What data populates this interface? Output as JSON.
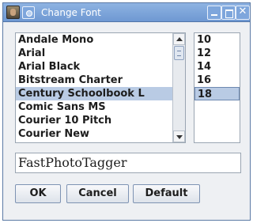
{
  "window": {
    "title": "Change Font"
  },
  "font_list": {
    "items": [
      {
        "label": "Andale Mono"
      },
      {
        "label": "Arial"
      },
      {
        "label": "Arial Black"
      },
      {
        "label": "Bitstream Charter"
      },
      {
        "label": "Century Schoolbook L",
        "selected": true
      },
      {
        "label": "Comic Sans MS"
      },
      {
        "label": "Courier 10 Pitch"
      },
      {
        "label": "Courier New"
      }
    ]
  },
  "size_list": {
    "items": [
      {
        "label": "10"
      },
      {
        "label": "12"
      },
      {
        "label": "14"
      },
      {
        "label": "16"
      },
      {
        "label": "18",
        "selected": true
      }
    ]
  },
  "preview": {
    "text": "FastPhotoTagger"
  },
  "buttons": {
    "ok_label": "OK",
    "cancel_label": "Cancel",
    "default_label": "Default"
  },
  "icons": {
    "app": "app-photo-icon",
    "menu": "window-menu-icon",
    "minimize": "minimize-icon",
    "maximize": "maximize-icon",
    "close": "close-icon"
  },
  "colors": {
    "titlebar": "#7ea6dc",
    "selection": "#b9cbe4"
  }
}
